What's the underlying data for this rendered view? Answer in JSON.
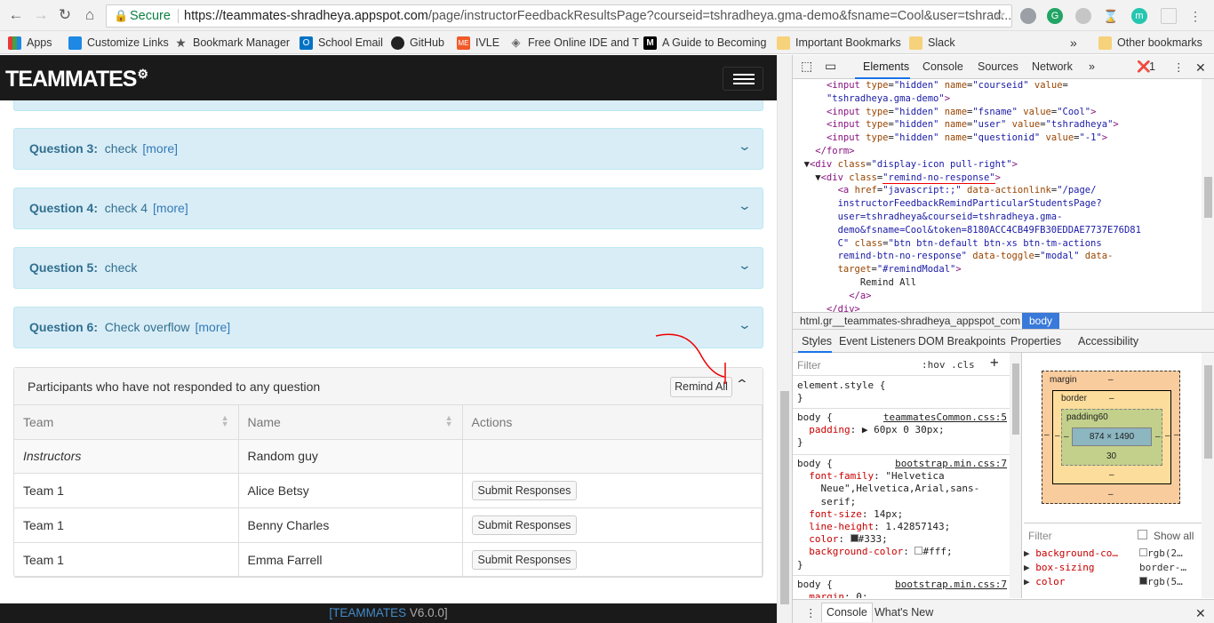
{
  "browser": {
    "secure_label": "Secure",
    "url_host": "https://teammates-shradheya.appspot.com",
    "url_path": "/page/instructorFeedbackResultsPage?courseid=tshradheya.gma-demo&fsname=Cool&user=tshrad...",
    "bookmarks": [
      "Apps",
      "Customize Links",
      "Bookmark Manager",
      "School Email",
      "GitHub",
      "IVLE",
      "Free Online IDE and T",
      "A Guide to Becoming",
      "Important Bookmarks",
      "Slack"
    ],
    "other_bookmarks": "Other bookmarks",
    "more_chevron": "»"
  },
  "app": {
    "logo": "TEAMMATES",
    "questions": [
      {
        "num": "Question 3:",
        "text": "check",
        "more": "[more]"
      },
      {
        "num": "Question 4:",
        "text": "check 4",
        "more": "[more]"
      },
      {
        "num": "Question 5:",
        "text": "check",
        "more": ""
      },
      {
        "num": "Question 6:",
        "text": "Check overflow",
        "more": "[more]"
      }
    ],
    "no_response": {
      "title": "Participants who have not responded to any question",
      "remind_label": "Remind All",
      "headers": [
        "Team",
        "Name",
        "Actions"
      ],
      "rows": [
        {
          "team": "Instructors",
          "name": "Random guy",
          "action": ""
        },
        {
          "team": "Team 1",
          "name": "Alice Betsy",
          "action": "Submit Responses"
        },
        {
          "team": "Team 1",
          "name": "Benny Charles",
          "action": "Submit Responses"
        },
        {
          "team": "Team 1",
          "name": "Emma Farrell",
          "action": "Submit Responses"
        }
      ]
    },
    "footer_brand": "[TEAMMATES",
    "footer_version": "V6.0.0]"
  },
  "devtools": {
    "tabs": [
      "Elements",
      "Console",
      "Sources",
      "Network"
    ],
    "error_count": "1",
    "breadcrumb_html": "html.gr__teammates-shradheya_appspot_com",
    "breadcrumb_body": "body",
    "style_tabs": [
      "Styles",
      "Event Listeners",
      "DOM Breakpoints",
      "Properties",
      "Accessibility"
    ],
    "styles_filter": "Filter",
    "hov_cls": ":hov  .cls",
    "rule_element_style": "element.style {",
    "rule1_src": "teammatesCommon.css:5",
    "rule2_src": "bootstrap.min.css:7",
    "rule3_src": "bootstrap.min.css:7",
    "box_margin": "margin",
    "box_border": "border",
    "box_padding": "padding60",
    "box_content": "874 × 1490",
    "box_dash": "–",
    "box_pad_bottom": "30",
    "computed_filter": "Filter",
    "show_all": "Show all",
    "computed": [
      {
        "prop": "background-co…",
        "val": "rgb(2…"
      },
      {
        "prop": "box-sizing",
        "val": "border-…"
      },
      {
        "prop": "color",
        "val": "rgb(5…"
      }
    ],
    "drawer_tabs": [
      "Console",
      "What's New"
    ]
  }
}
